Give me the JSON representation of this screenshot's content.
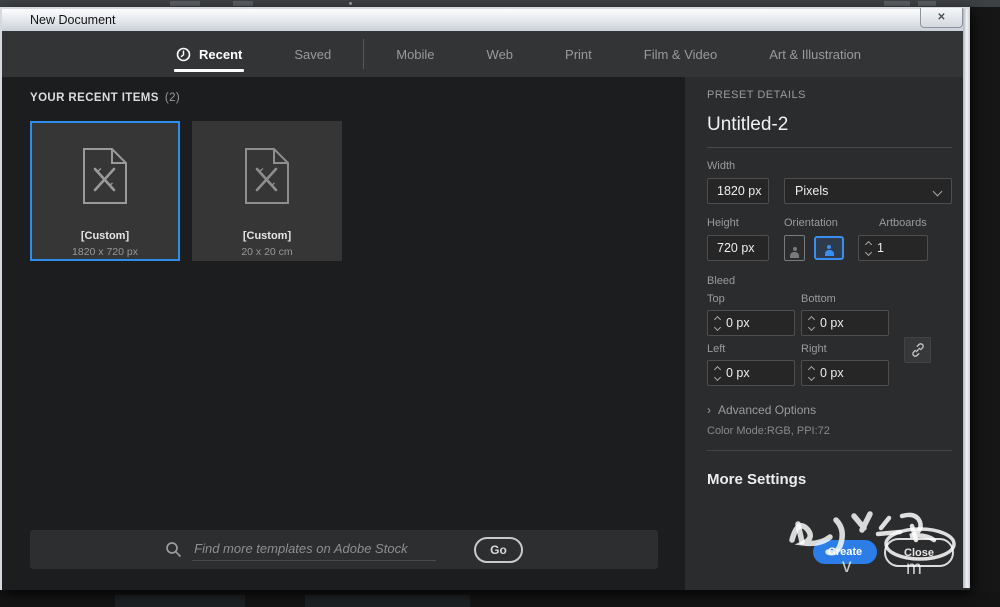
{
  "window": {
    "title": "New Document",
    "close_glyph": "✕"
  },
  "tabs": {
    "items": [
      {
        "label": "Recent",
        "active": true
      },
      {
        "label": "Saved",
        "active": false
      },
      {
        "label": "Mobile",
        "active": false
      },
      {
        "label": "Web",
        "active": false
      },
      {
        "label": "Print",
        "active": false
      },
      {
        "label": "Film & Video",
        "active": false
      },
      {
        "label": "Art & Illustration",
        "active": false
      }
    ]
  },
  "recent": {
    "heading": "YOUR RECENT ITEMS",
    "count": "(2)",
    "items": [
      {
        "name": "[Custom]",
        "size": "1820 x 720 px",
        "selected": true
      },
      {
        "name": "[Custom]",
        "size": "20 x 20 cm",
        "selected": false
      }
    ]
  },
  "preset": {
    "heading": "PRESET DETAILS",
    "name": "Untitled-2",
    "width_label": "Width",
    "width_value": "1820 px",
    "units_value": "Pixels",
    "height_label": "Height",
    "height_value": "720 px",
    "orientation_label": "Orientation",
    "artboards_label": "Artboards",
    "artboards_value": "1",
    "bleed_label": "Bleed",
    "bleed": {
      "top_label": "Top",
      "top_value": "0 px",
      "bottom_label": "Bottom",
      "bottom_value": "0 px",
      "left_label": "Left",
      "left_value": "0 px",
      "right_label": "Right",
      "right_value": "0 px"
    },
    "advanced_label": "Advanced Options",
    "advanced_arrow": "›",
    "color_mode": "Color Mode:RGB, PPI:72",
    "more_settings": "More Settings"
  },
  "footer": {
    "search_placeholder": "Find more templates on Adobe Stock",
    "go_label": "Go"
  },
  "actions": {
    "create_label": "Create",
    "close_label": "Close"
  },
  "watermark": {
    "fragment_1": "v",
    "fragment_2": "m"
  },
  "colors": {
    "accent_blue": "#2e8ceb",
    "create_blue": "#2c7de8",
    "panel_bg": "#2b2c2e",
    "content_bg": "#1c1d1e"
  }
}
